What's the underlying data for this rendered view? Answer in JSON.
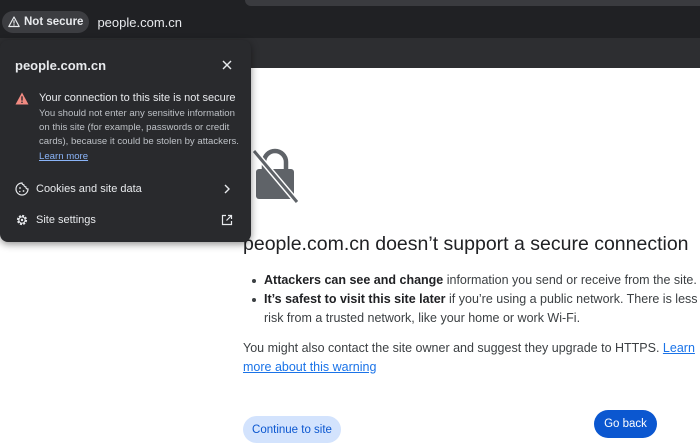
{
  "browser": {
    "security_chip_label": "Not secure",
    "url": "people.com.cn"
  },
  "popup": {
    "domain": "people.com.cn",
    "warning_title": "Your connection to this site is not secure",
    "warning_body": "You should not enter any sensitive information on this site (for example, passwords or credit cards), because it could be stolen by attackers.",
    "learn_more": "Learn more",
    "rows": [
      {
        "label": "Cookies and site data"
      },
      {
        "label": "Site settings"
      }
    ]
  },
  "page": {
    "title": "people.com.cn doesn’t support a secure connection",
    "bullet1_bold": "Attackers can see and change",
    "bullet1_rest": " information you send or receive from the site.",
    "bullet2_bold": "It’s safest to visit this site later",
    "bullet2_rest": " if you’re using a public network. There is less risk from a trusted network, like your home or work Wi-Fi.",
    "contact_text": "You might also contact the site owner and suggest they upgrade to HTTPS. ",
    "contact_link": "Learn more about this warning",
    "continue_label": "Continue to site",
    "back_label": "Go back"
  },
  "colors": {
    "primary": "#0b57d0",
    "warning": "#f28b82",
    "link": "#1a73e8"
  }
}
